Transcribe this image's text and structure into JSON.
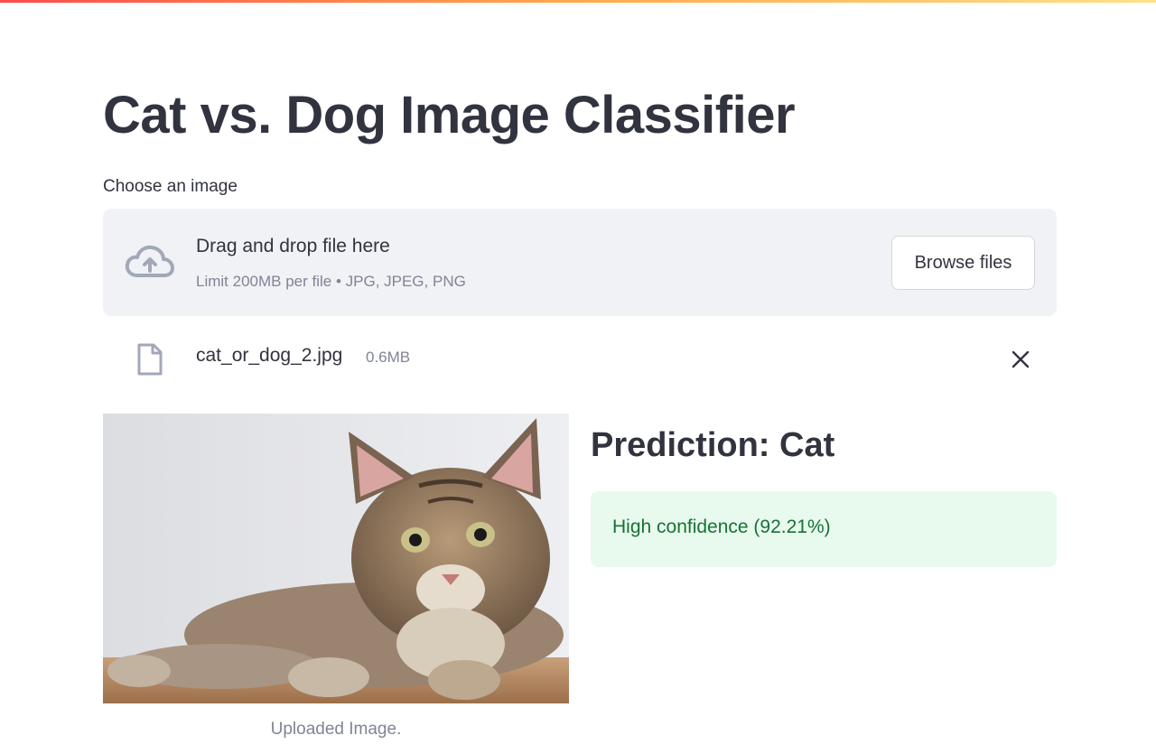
{
  "page": {
    "title": "Cat vs. Dog Image Classifier"
  },
  "uploader": {
    "label": "Choose an image",
    "drop_title": "Drag and drop file here",
    "drop_subtitle": "Limit 200MB per file • JPG, JPEG, PNG",
    "browse_label": "Browse files",
    "icon": "cloud-upload-icon"
  },
  "uploaded_file": {
    "name": "cat_or_dog_2.jpg",
    "size": "0.6MB",
    "icon": "file-icon",
    "remove_icon": "close-icon"
  },
  "image": {
    "caption": "Uploaded Image."
  },
  "result": {
    "prediction": "Prediction: Cat",
    "confidence": "High confidence (92.21%)"
  },
  "colors": {
    "text": "#31333f",
    "muted": "#808495",
    "dropzone_bg": "#f0f2f6",
    "success_bg": "#e8f9ee",
    "success_text": "#177233",
    "accent_gradient": [
      "#ff4b4b",
      "#ffa94b",
      "#ffe08a"
    ]
  }
}
